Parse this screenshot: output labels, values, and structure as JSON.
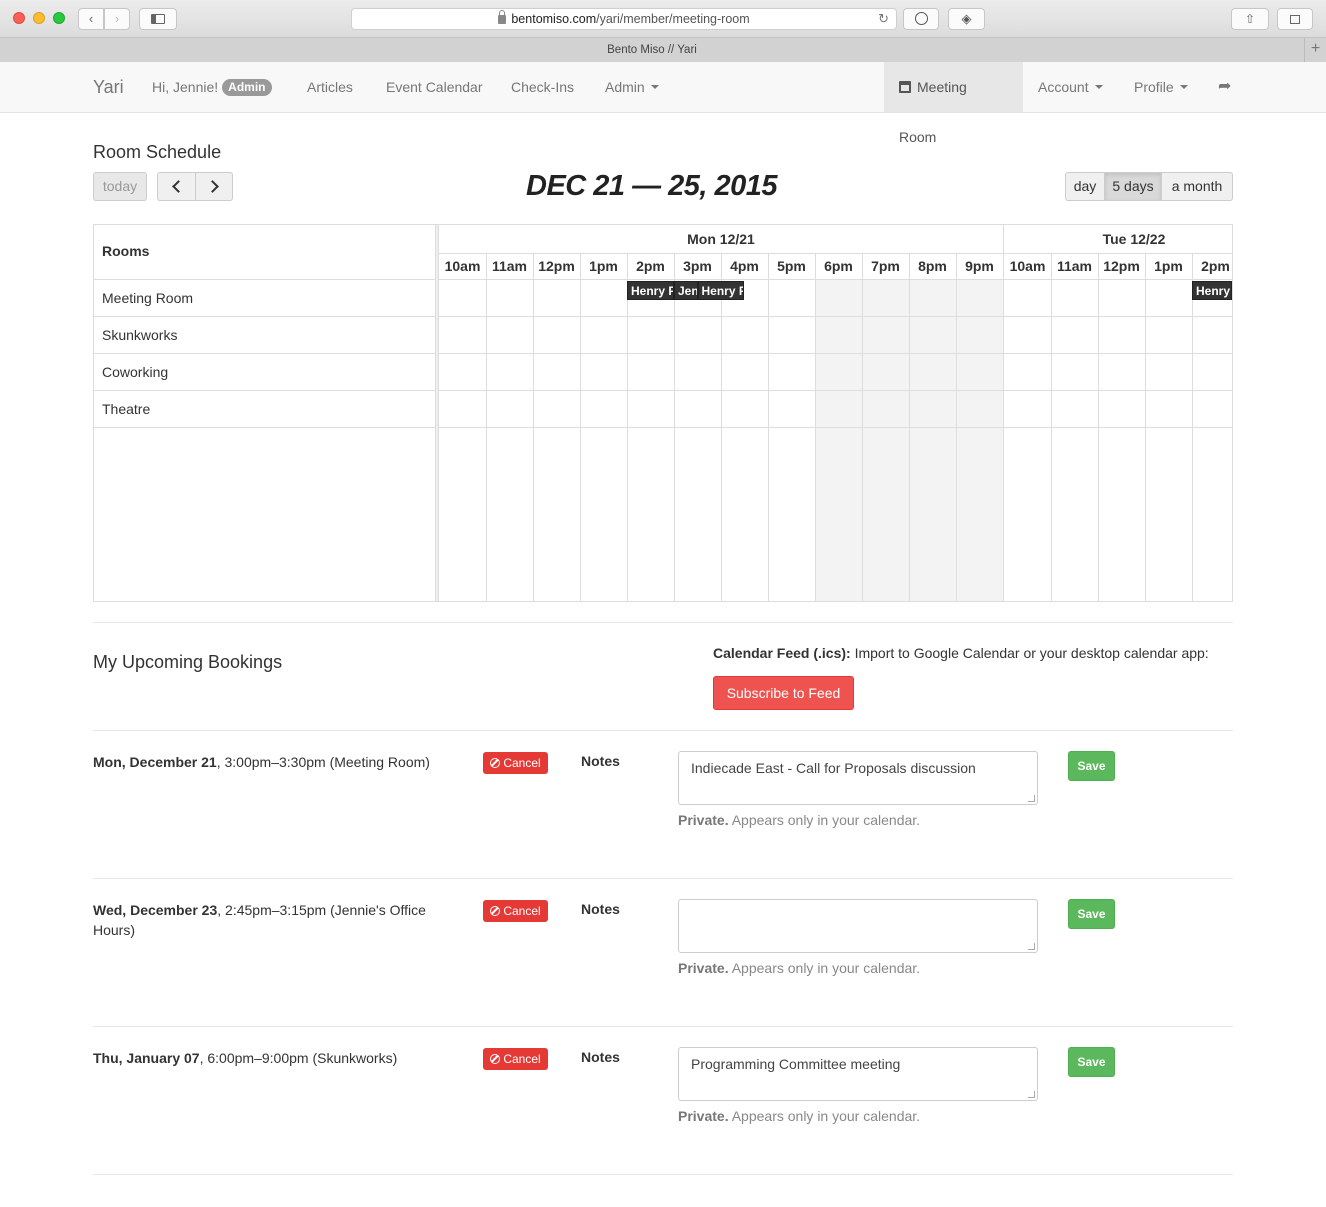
{
  "browser": {
    "url_host": "bentomiso.com",
    "url_path": "/yari/member/meeting-room",
    "tab_title": "Bento Miso // Yari"
  },
  "nav": {
    "brand": "Yari",
    "greeting": "Hi, Jennie!",
    "badge": "Admin",
    "articles": "Articles",
    "event_calendar": "Event Calendar",
    "check_ins": "Check-Ins",
    "admin": "Admin",
    "meeting_room": "Meeting Room",
    "account": "Account",
    "profile": "Profile"
  },
  "schedule": {
    "title": "Room Schedule",
    "today": "today",
    "date_range": "DEC 21 — 25, 2015",
    "views": {
      "day": "day",
      "five_days": "5 days",
      "month": "a month"
    },
    "rooms_header": "Rooms",
    "rooms": [
      "Meeting Room",
      "Skunkworks",
      "Coworking",
      "Theatre"
    ],
    "days": [
      {
        "label": "Mon 12/21",
        "hours": [
          "10am",
          "11am",
          "12pm",
          "1pm",
          "2pm",
          "3pm",
          "4pm",
          "5pm",
          "6pm",
          "7pm",
          "8pm",
          "9pm"
        ]
      },
      {
        "label": "Tue 12/22",
        "hours": [
          "10am",
          "11am",
          "12pm",
          "1pm",
          "2pm"
        ]
      }
    ],
    "events": [
      {
        "label": "Henry F",
        "room": "Meeting Room",
        "day": "Mon 12/21",
        "start": "2pm"
      },
      {
        "label": "Jen",
        "room": "Meeting Room",
        "day": "Mon 12/21",
        "start": "3pm"
      },
      {
        "label": "Henry F",
        "room": "Meeting Room",
        "day": "Mon 12/21",
        "start": "3:30pm"
      },
      {
        "label": "Henry",
        "room": "Meeting Room",
        "day": "Tue 12/22",
        "start": "2pm"
      }
    ]
  },
  "bookings": {
    "title": "My Upcoming Bookings",
    "feed_label": "Calendar Feed (.ics):",
    "feed_text": "Import to Google Calendar or your desktop calendar app:",
    "subscribe": "Subscribe to Feed",
    "cancel_label": "Cancel",
    "notes_label": "Notes",
    "private_label": "Private.",
    "private_text": "Appears only in your calendar.",
    "save_label": "Save",
    "items": [
      {
        "date": "Mon, December 21",
        "detail": ", 3:00pm–3:30pm (Meeting Room)",
        "notes": "Indiecade East - Call for Proposals discussion"
      },
      {
        "date": "Wed, December 23",
        "detail": ", 2:45pm–3:15pm (Jennie's Office Hours)",
        "notes": ""
      },
      {
        "date": "Thu, January 07",
        "detail": ", 6:00pm–9:00pm (Skunkworks)",
        "notes": "Programming Committee meeting"
      }
    ]
  }
}
